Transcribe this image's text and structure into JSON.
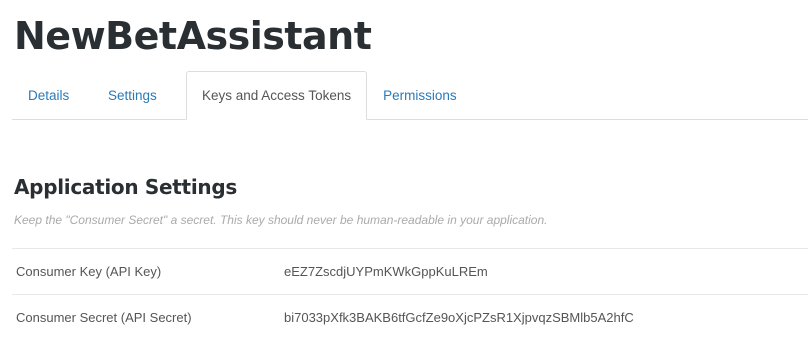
{
  "app": {
    "title": "NewBetAssistant"
  },
  "tabs": [
    {
      "label": "Details",
      "active": false
    },
    {
      "label": "Settings",
      "active": false
    },
    {
      "label": "Keys and Access Tokens",
      "active": true
    },
    {
      "label": "Permissions",
      "active": false
    }
  ],
  "section": {
    "title": "Application Settings",
    "help": "Keep the \"Consumer Secret\" a secret. This key should never be human-readable in your application."
  },
  "settings": [
    {
      "label": "Consumer Key (API Key)",
      "value": "eEZ7ZscdjUYPmKWkGppKuLREm"
    },
    {
      "label": "Consumer Secret (API Secret)",
      "value": "bi7033pXfk3BAKB6tfGcfZe9oXjcPZsR1XjpvqzSBMlb5A2hfC"
    }
  ],
  "colors": {
    "link": "#2a7ab8",
    "title": "#292f33",
    "text": "#555555",
    "help": "#aaaaaa",
    "border": "#dddddd"
  }
}
